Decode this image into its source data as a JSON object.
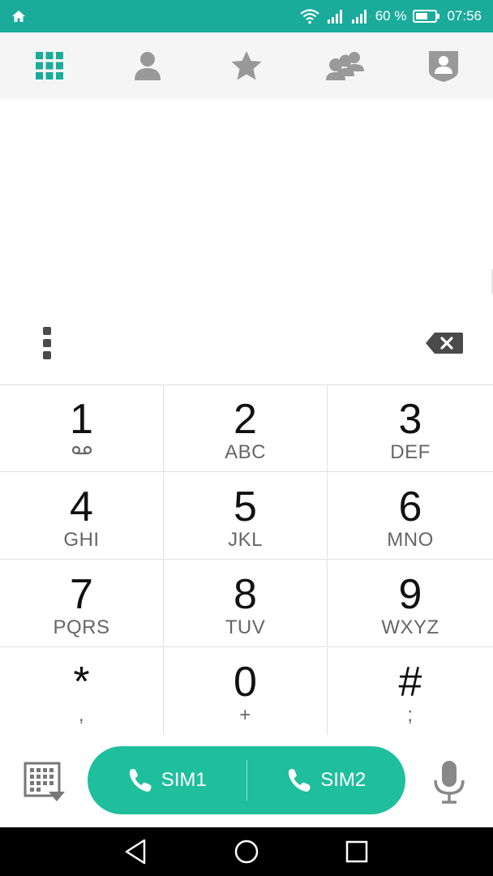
{
  "status_bar": {
    "battery_text": "60 %",
    "time": "07:56",
    "background": "#1aab9b"
  },
  "tabs": [
    {
      "icon": "dialpad-icon",
      "active": true
    },
    {
      "icon": "person-icon",
      "active": false
    },
    {
      "icon": "star-icon",
      "active": false
    },
    {
      "icon": "groups-icon",
      "active": false
    },
    {
      "icon": "contact-shield-icon",
      "active": false
    }
  ],
  "keypad": [
    {
      "digit": "1",
      "letters": "",
      "sub_icon": "voicemail-icon"
    },
    {
      "digit": "2",
      "letters": "ABC"
    },
    {
      "digit": "3",
      "letters": "DEF"
    },
    {
      "digit": "4",
      "letters": "GHI"
    },
    {
      "digit": "5",
      "letters": "JKL"
    },
    {
      "digit": "6",
      "letters": "MNO"
    },
    {
      "digit": "7",
      "letters": "PQRS"
    },
    {
      "digit": "8",
      "letters": "TUV"
    },
    {
      "digit": "9",
      "letters": "WXYZ"
    },
    {
      "digit": "*",
      "letters": ","
    },
    {
      "digit": "0",
      "letters": "+"
    },
    {
      "digit": "#",
      "letters": ";"
    }
  ],
  "call_actions": {
    "sim1_label": "SIM1",
    "sim2_label": "SIM2",
    "accent": "#1fbf9d"
  }
}
